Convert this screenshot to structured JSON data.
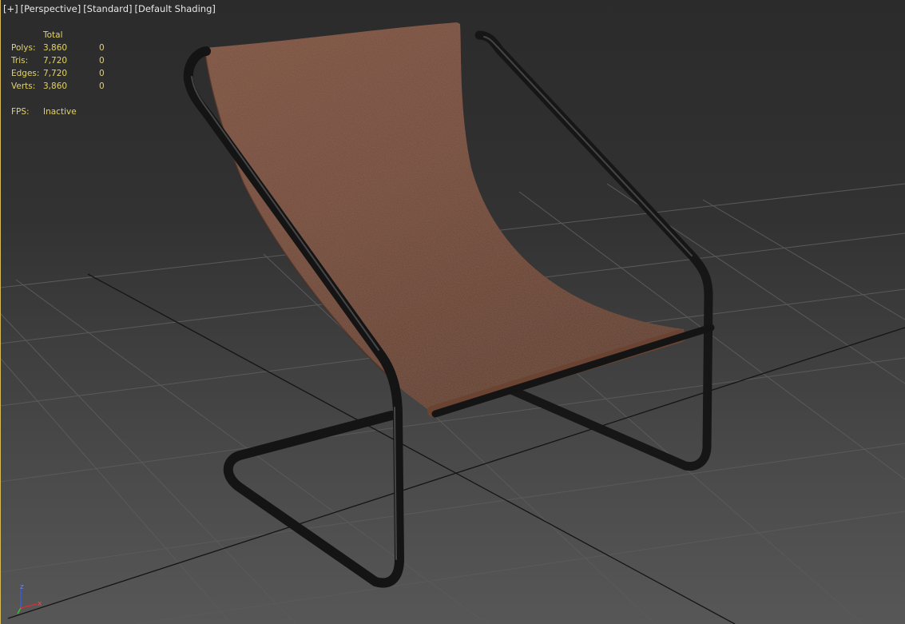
{
  "viewport": {
    "labels": [
      "[+]",
      "[Perspective]",
      "[Standard]",
      "[Default Shading]"
    ]
  },
  "stats": {
    "header": "Total",
    "rows": [
      {
        "label": "Polys:",
        "total": "3,860",
        "selected": "0"
      },
      {
        "label": "Tris:",
        "total": "7,720",
        "selected": "0"
      },
      {
        "label": "Edges:",
        "total": "7,720",
        "selected": "0"
      },
      {
        "label": "Verts:",
        "total": "3,860",
        "selected": "0"
      }
    ],
    "fps_label": "FPS:",
    "fps_value": "Inactive"
  },
  "gizmo": {
    "z": "z",
    "x": "x"
  },
  "colors": {
    "stats_text": "#e2d36a",
    "grid_line": "#5a5a5a",
    "grid_axis": "#141414",
    "leather": "#7a4f3a",
    "frame": "#161616",
    "axis_x": "#d03030",
    "axis_y": "#30c030",
    "axis_z": "#3a5ad8"
  }
}
